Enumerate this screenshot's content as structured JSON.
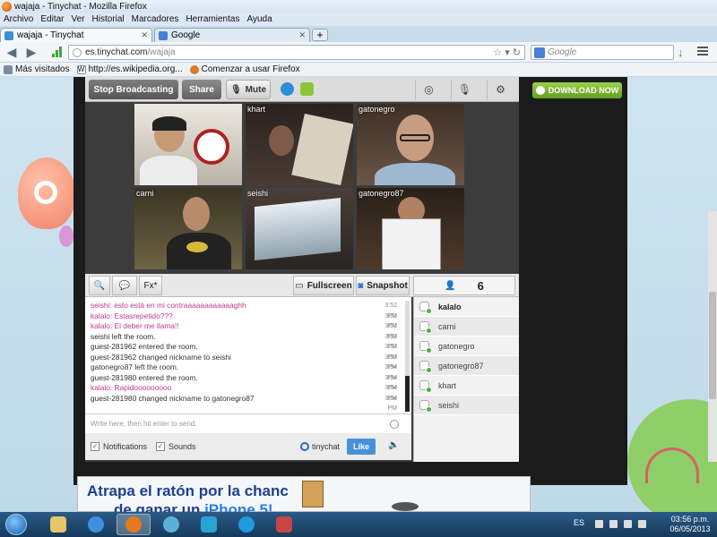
{
  "window": {
    "title": "wajaja - Tinychat - Mozilla Firefox"
  },
  "menu": [
    "Archivo",
    "Editar",
    "Ver",
    "Historial",
    "Marcadores",
    "Herramientas",
    "Ayuda"
  ],
  "tabs": [
    {
      "label": "wajaja - Tinychat",
      "icon": "tinychat-icon",
      "active": true
    },
    {
      "label": "Google",
      "icon": "google-icon",
      "active": false
    }
  ],
  "new_tab": "+",
  "nav": {
    "url_host": "es.tinychat.com",
    "url_path": "/wajaja",
    "search_placeholder": "Google"
  },
  "bookmarks": [
    "Más visitados",
    "http://es.wikipedia.org...",
    "Comenzar a usar Firefox"
  ],
  "page": {
    "download_label": "DOWNLOAD NOW",
    "ad": {
      "line1": "Atrapa el ratón por la chanc",
      "line2a": "de ganar un ",
      "line2b": "iPhone 5!"
    }
  },
  "tinychat": {
    "toolbar": {
      "broadcast": "Stop Broadcasting",
      "share": "Share",
      "mute": "Mute"
    },
    "cams": [
      {
        "name": ""
      },
      {
        "name": "khart"
      },
      {
        "name": "gatonegro"
      },
      {
        "name": "carni"
      },
      {
        "name": "seishi"
      },
      {
        "name": "gatonegro87"
      }
    ],
    "bar2": {
      "fx": "Fx*",
      "fullscreen": "Fullscreen",
      "snapshot": "Snapshot",
      "user_count": "6"
    },
    "messages": [
      {
        "text": "seishi: esto está en mi contraaaaaaaaaaaaghh",
        "time": "3:52 PM",
        "style": "pink"
      },
      {
        "text": "kalalo: Estasrepetido???",
        "time": "3:52 PM",
        "style": "pink"
      },
      {
        "text": "kalalo: El deber me llama!!",
        "time": "3:53 PM",
        "style": "pink"
      },
      {
        "text": "seishi left the room.",
        "time": "3:53 PM",
        "style": "dark"
      },
      {
        "text": "guest-281962 entered the room.",
        "time": "3:53 PM",
        "style": "dark"
      },
      {
        "text": "guest-281962 changed nickname to seishi",
        "time": "3:53 PM",
        "style": "dark"
      },
      {
        "text": "gatonegro87 left the room.",
        "time": "3:54 PM",
        "style": "dark"
      },
      {
        "text": "guest-281980 entered the room.",
        "time": "3:54 PM",
        "style": "dark"
      },
      {
        "text": "kalalo: Rapidooooooooo",
        "time": "3:54 PM",
        "style": "pink"
      },
      {
        "text": "guest-281980 changed nickname to gatonegro87",
        "time": "3:54 PM",
        "style": "dark"
      }
    ],
    "users": [
      "kalalo",
      "carni",
      "gatonegro",
      "gatonegro87",
      "khart",
      "seishi"
    ],
    "input_placeholder": "Write here, then hit enter to send.",
    "options": {
      "notifications": "Notifications",
      "sounds": "Sounds",
      "brand": "tinychat",
      "like": "Like"
    }
  },
  "taskbar": {
    "lang": "ES",
    "time": "03:56 p.m.",
    "date": "06/05/2013"
  }
}
